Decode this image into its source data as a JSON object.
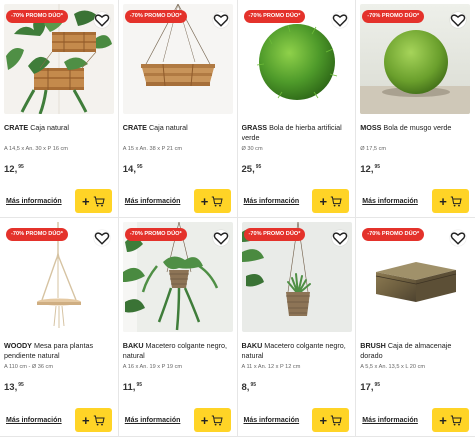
{
  "accent": "#ffd426",
  "badge_color": "#e4322b",
  "products": [
    {
      "badge": "-70% PROMO DÚO*",
      "brand": "CRATE",
      "name": "Caja natural",
      "dims": "A 14,5 x An. 30 x P 16 cm",
      "price_int": "12,",
      "price_dec": "95",
      "more": "Más información"
    },
    {
      "badge": "-70% PROMO DÚO*",
      "brand": "CRATE",
      "name": "Caja natural",
      "dims": "A 15 x An. 38 x P 21 cm",
      "price_int": "14,",
      "price_dec": "95",
      "more": "Más información"
    },
    {
      "badge": "-70% PROMO DÚO*",
      "brand": "GRASS",
      "name": "Bola de hierba artificial verde",
      "dims": "Ø 30 cm",
      "price_int": "25,",
      "price_dec": "95",
      "more": "Más información"
    },
    {
      "badge": "-70% PROMO DÚO*",
      "brand": "MOSS",
      "name": "Bola de musgo verde",
      "dims": "Ø 17,5 cm",
      "price_int": "12,",
      "price_dec": "95",
      "more": "Más información"
    },
    {
      "badge": "-70% PROMO DÚO*",
      "brand": "WOODY",
      "name": "Mesa para plantas pendiente natural",
      "dims": "A 110 cm - Ø 36 cm",
      "price_int": "13,",
      "price_dec": "95",
      "more": "Más información"
    },
    {
      "badge": "-70% PROMO DÚO*",
      "brand": "BAKU",
      "name": "Macetero colgante negro, natural",
      "dims": "A 16 x An. 19 x P 19 cm",
      "price_int": "11,",
      "price_dec": "95",
      "more": "Más información"
    },
    {
      "badge": "-70% PROMO DÚO*",
      "brand": "BAKU",
      "name": "Macetero colgante negro, natural",
      "dims": "A 11 x An. 12 x P 12 cm",
      "price_int": "8,",
      "price_dec": "95",
      "more": "Más información"
    },
    {
      "badge": "-70% PROMO DÚO*",
      "brand": "BRUSH",
      "name": "Caja de almacenaje dorado",
      "dims": "A 5,5 x An. 13,5 x L 20 cm",
      "price_int": "17,",
      "price_dec": "95",
      "more": "Más información"
    }
  ]
}
